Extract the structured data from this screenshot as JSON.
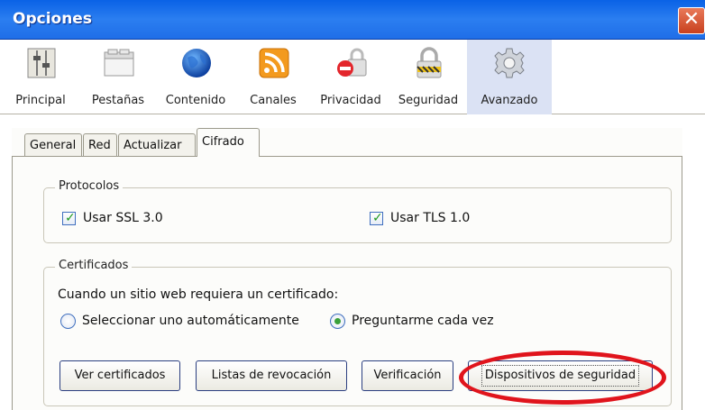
{
  "window": {
    "title": "Opciones",
    "close_glyph": "✕"
  },
  "toolbar": {
    "items": [
      {
        "label": "Principal",
        "icon": "switch-panel-icon"
      },
      {
        "label": "Pestañas",
        "icon": "tabs-window-icon"
      },
      {
        "label": "Contenido",
        "icon": "globe-icon"
      },
      {
        "label": "Canales",
        "icon": "rss-feed-icon"
      },
      {
        "label": "Privacidad",
        "icon": "lock-no-entry-icon"
      },
      {
        "label": "Seguridad",
        "icon": "padlock-warning-icon"
      },
      {
        "label": "Avanzado",
        "icon": "gear-icon"
      }
    ],
    "active": "Avanzado"
  },
  "tabs": [
    "General",
    "Red",
    "Actualizar",
    "Cifrado"
  ],
  "active_tab": "Cifrado",
  "protocols": {
    "legend": "Protocolos",
    "ssl_label": "Usar SSL 3.0",
    "tls_label": "Usar TLS 1.0",
    "ssl_checked": true,
    "tls_checked": true
  },
  "certificates": {
    "legend": "Certificados",
    "prompt": "Cuando un sitio web requiera un certificado:",
    "option_auto": "Seleccionar uno automáticamente",
    "option_ask": "Preguntarme cada vez",
    "selected": "option_ask"
  },
  "buttons": {
    "view_certs": "Ver certificados",
    "revocation": "Listas de revocación",
    "verification": "Verificación",
    "security_devices": "Dispositivos de seguridad"
  },
  "colors": {
    "title_bar": "#0a62e6",
    "highlight": "#e0141c",
    "active_toolbar": "#dbe2f4"
  }
}
